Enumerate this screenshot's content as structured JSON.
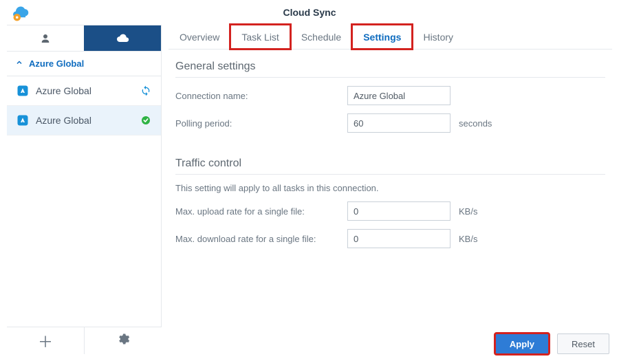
{
  "app": {
    "title": "Cloud Sync"
  },
  "sidebar": {
    "group": "Azure Global",
    "connections": [
      {
        "label": "Azure Global",
        "status": "sync"
      },
      {
        "label": "Azure Global",
        "status": "ok",
        "selected": true
      }
    ]
  },
  "tabs": [
    {
      "label": "Overview"
    },
    {
      "label": "Task List",
      "highlight": true
    },
    {
      "label": "Schedule"
    },
    {
      "label": "Settings",
      "active": true,
      "highlight": true
    },
    {
      "label": "History"
    }
  ],
  "general": {
    "heading": "General settings",
    "conn_name_label": "Connection name:",
    "conn_name_value": "Azure Global",
    "polling_label": "Polling period:",
    "polling_value": "60",
    "polling_unit": "seconds"
  },
  "traffic": {
    "heading": "Traffic control",
    "note": "This setting will apply to all tasks in this connection.",
    "upload_label": "Max. upload rate for a single file:",
    "upload_value": "0",
    "download_label": "Max. download rate for a single file:",
    "download_value": "0",
    "unit": "KB/s"
  },
  "footer": {
    "apply": "Apply",
    "reset": "Reset"
  }
}
